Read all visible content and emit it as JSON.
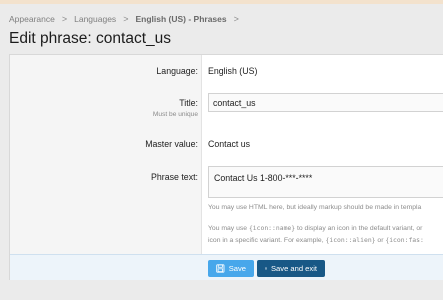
{
  "breadcrumb": {
    "items": [
      "Appearance",
      "Languages",
      "English (US) - Phrases"
    ],
    "separator": ">"
  },
  "page": {
    "title": "Edit phrase: contact_us"
  },
  "form": {
    "language": {
      "label": "Language:",
      "value": "English (US)"
    },
    "title": {
      "label": "Title:",
      "hint": "Must be unique",
      "value": "contact_us"
    },
    "master_value": {
      "label": "Master value:",
      "value": "Contact us"
    },
    "phrase_text": {
      "label": "Phrase text:",
      "value": "Contact Us 1-800-***-****",
      "explain_1": "You may use HTML here, but ideally markup should be made in templa",
      "explain_2_a": "You may use ",
      "explain_2_code": "{icon::name}",
      "explain_2_b": " to display an icon in the default variant, or",
      "explain_3_a": "icon in a specific variant. For example, ",
      "explain_3_code_1": "{icon::alien}",
      "explain_3_mid": " or ",
      "explain_3_code_2": "{icon:fas:"
    }
  },
  "buttons": {
    "save": "Save",
    "save_exit": "Save and exit"
  },
  "colors": {
    "primary_button": "#47a7eb",
    "secondary_button": "#185886",
    "footer_bg": "#edf4fa"
  },
  "icons": {
    "save": "floppy-disk-icon",
    "breadcrumb_sep": "chevron-right-icon"
  }
}
